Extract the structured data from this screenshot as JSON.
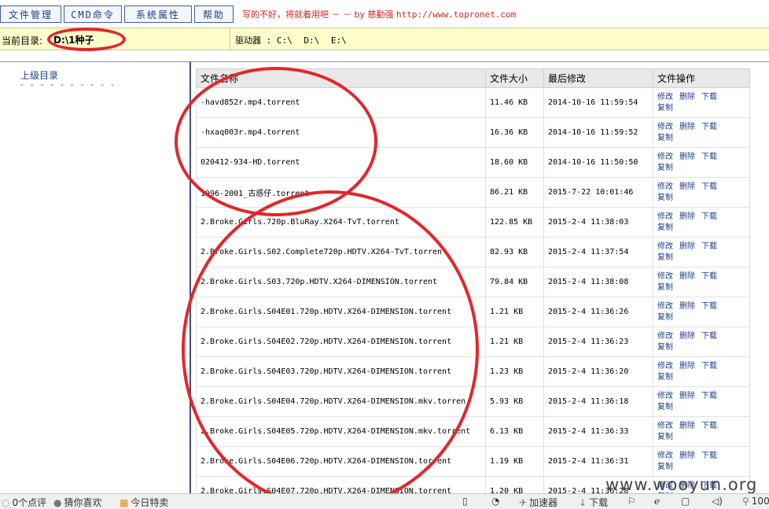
{
  "menu": {
    "file_manager": "文件管理",
    "cmd": "CMD命令",
    "sys_props": "系统属性",
    "help": "帮助"
  },
  "motto": {
    "text": "写的不好，将就着用吧 － － by 慈勤强",
    "url": "http://www.topronet.com"
  },
  "pathbar": {
    "label": "当前目录:",
    "path": "D:\\1种子",
    "drives_label": "驱动器 :",
    "drives": [
      "C:\\",
      "D:\\",
      "E:\\"
    ]
  },
  "sidebar": {
    "up_label": "上级目录",
    "up_dash": "- - - - - - - - - -"
  },
  "table": {
    "headers": [
      "文件名称",
      "文件大小",
      "最后修改",
      "文件操作"
    ],
    "op_edit": "修改",
    "op_delete": "删除",
    "op_download": "下载",
    "op_copy": "复制",
    "rows": [
      {
        "name": "-havd852r.mp4.torrent",
        "size": "11.46 KB",
        "date": "2014-10-16 11:59:54"
      },
      {
        "name": "-hxaq003r.mp4.torrent",
        "size": "16.36 KB",
        "date": "2014-10-16 11:59:52"
      },
      {
        "name": "020412-934-HD.torrent",
        "size": "18.60 KB",
        "date": "2014-10-16 11:50:50"
      },
      {
        "name": "1996-2001_古惑仔.torrent",
        "size": "86.21 KB",
        "date": "2015-7-22 10:01:46"
      },
      {
        "name": "2.Broke.Girls.720p.BluRay.X264-TvT.torrent",
        "size": "122.85 KB",
        "date": "2015-2-4 11:38:03"
      },
      {
        "name": "2.Broke.Girls.S02.Complete720p.HDTV.X264-TvT.torren",
        "size": "82.93 KB",
        "date": "2015-2-4 11:37:54"
      },
      {
        "name": "2.Broke.Girls.S03.720p.HDTV.X264-DIMENSION.torrent",
        "size": "79.84 KB",
        "date": "2015-2-4 11:38:08"
      },
      {
        "name": "2.Broke.Girls.S04E01.720p.HDTV.X264-DIMENSION.torrent",
        "size": "1.21 KB",
        "date": "2015-2-4 11:36:26"
      },
      {
        "name": "2.Broke.Girls.S04E02.720p.HDTV.X264-DIMENSION.torrent",
        "size": "1.21 KB",
        "date": "2015-2-4 11:36:23"
      },
      {
        "name": "2.Broke.Girls.S04E03.720p.HDTV.X264-DIMENSION.torrent",
        "size": "1.23 KB",
        "date": "2015-2-4 11:36:20"
      },
      {
        "name": "2.Broke.Girls.S04E04.720p.HDTV.X264-DIMENSION.mkv.torren",
        "size": "5.93 KB",
        "date": "2015-2-4 11:36:18"
      },
      {
        "name": "2.Broke.Girls.S04E05.720p.HDTV.X264-DIMENSION.mkv.torrent",
        "size": "6.13 KB",
        "date": "2015-2-4 11:36:33"
      },
      {
        "name": "2.Broke.Girls.S04E06.720p.HDTV.X264-DIMENSION.torrent",
        "size": "1.19 KB",
        "date": "2015-2-4 11:36:31"
      },
      {
        "name": "2.Broke.Girls.S04E07.720p.HDTV.X264-DIMENSION.torrent",
        "size": "1.20 KB",
        "date": "2015-2-4 11:36:28"
      }
    ]
  },
  "watermark": "www.wooyun.org",
  "statusbar": {
    "comments": "0个点评",
    "guess": "猜你喜欢",
    "today": "今日特卖",
    "accelerator": "加速器",
    "download": "下载",
    "zoom": "100"
  },
  "colors": {
    "annotation": "#e3262c",
    "path_bg": "#ffffcc",
    "link": "#1c3c8c",
    "motto": "#d42020"
  }
}
